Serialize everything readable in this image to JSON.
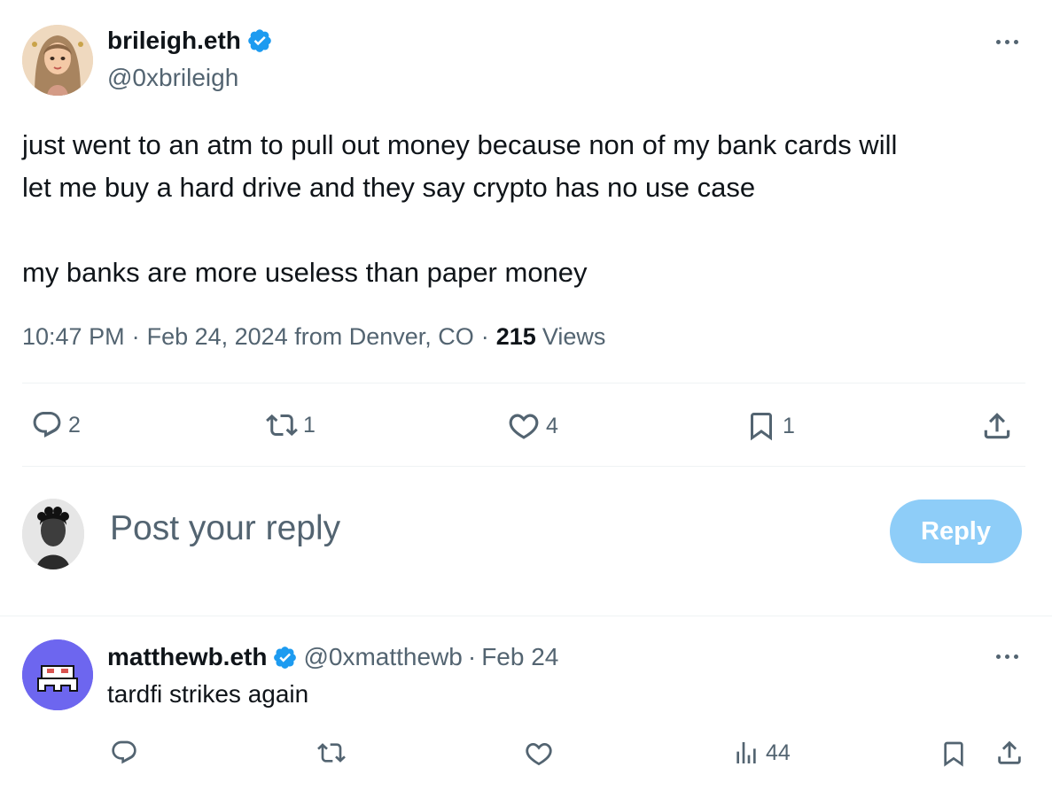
{
  "author": {
    "display_name": "brileigh.eth",
    "handle": "@0xbrileigh",
    "verified": true
  },
  "tweet": {
    "line1": "just went to an atm to pull out money because non of my bank cards will",
    "line2": "let me buy a hard drive and they say crypto has no use case",
    "line3": "my banks are more useless than paper money",
    "time": "10:47 PM",
    "sep1": "·",
    "date_location": "Feb 24, 2024 from Denver, CO",
    "sep2": "·",
    "views_count": "215",
    "views_label": "Views"
  },
  "actions": {
    "replies": "2",
    "reposts": "1",
    "likes": "4",
    "bookmarks": "1"
  },
  "composer": {
    "placeholder": "Post your reply",
    "reply_label": "Reply"
  },
  "reply": {
    "display_name": "matthewb.eth",
    "handle": "@0xmatthewb",
    "sep": "·",
    "date": "Feb 24",
    "text": "tardfi strikes again",
    "views": "44"
  },
  "colors": {
    "accent": "#1d9bf0",
    "reply_button": "#8ecdf8",
    "muted": "#536471",
    "text": "#0f1419",
    "divider": "#eff3f4"
  },
  "icons": [
    "verified-badge-icon",
    "more-icon",
    "reply-icon",
    "repost-icon",
    "like-icon",
    "bookmark-icon",
    "share-icon",
    "views-icon"
  ]
}
